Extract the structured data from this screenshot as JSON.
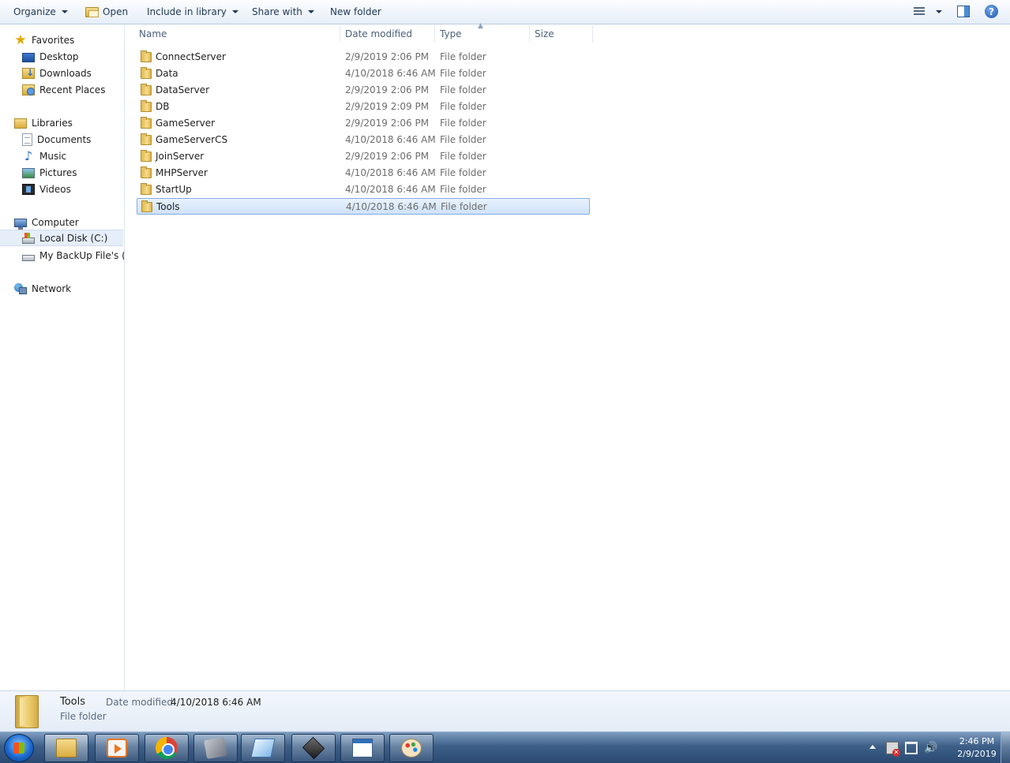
{
  "toolbar": {
    "organize": "Organize",
    "open": "Open",
    "include_in_library": "Include in library",
    "share_with": "Share with",
    "new_folder": "New folder"
  },
  "nav": {
    "favorites": "Favorites",
    "desktop": "Desktop",
    "downloads": "Downloads",
    "recent_places": "Recent Places",
    "libraries": "Libraries",
    "documents": "Documents",
    "music": "Music",
    "pictures": "Pictures",
    "videos": "Videos",
    "computer": "Computer",
    "local_disk": "Local Disk (C:)",
    "backup_disk": "My BackUp File's (D:",
    "network": "Network"
  },
  "columns": {
    "name": "Name",
    "date_modified": "Date modified",
    "type": "Type",
    "size": "Size"
  },
  "files": [
    {
      "name": "ConnectServer",
      "date": "2/9/2019 2:06 PM",
      "type": "File folder"
    },
    {
      "name": "Data",
      "date": "4/10/2018 6:46 AM",
      "type": "File folder"
    },
    {
      "name": "DataServer",
      "date": "2/9/2019 2:06 PM",
      "type": "File folder"
    },
    {
      "name": "DB",
      "date": "2/9/2019 2:09 PM",
      "type": "File folder"
    },
    {
      "name": "GameServer",
      "date": "2/9/2019 2:06 PM",
      "type": "File folder"
    },
    {
      "name": "GameServerCS",
      "date": "4/10/2018 6:46 AM",
      "type": "File folder"
    },
    {
      "name": "JoinServer",
      "date": "2/9/2019 2:06 PM",
      "type": "File folder"
    },
    {
      "name": "MHPServer",
      "date": "4/10/2018 6:46 AM",
      "type": "File folder"
    },
    {
      "name": "StartUp",
      "date": "4/10/2018 6:46 AM",
      "type": "File folder"
    },
    {
      "name": "Tools",
      "date": "4/10/2018 6:46 AM",
      "type": "File folder"
    }
  ],
  "selected_file": "Tools",
  "details": {
    "title": "Tools",
    "type": "File folder",
    "date_label": "Date modified:",
    "date_value": "4/10/2018 6:46 AM"
  },
  "taskbar": {
    "apps": [
      "explorer-icon",
      "media-player-icon",
      "chrome-icon",
      "tools-icon",
      "notepad-icon",
      "cube-app-icon",
      "window-app-icon",
      "paint-icon"
    ],
    "time": "2:46 PM",
    "date": "2/9/2019"
  },
  "colors": {
    "selection_bg": "#cfe2f9",
    "selection_border": "#84acdd",
    "taskbar": "#3d5f88"
  }
}
